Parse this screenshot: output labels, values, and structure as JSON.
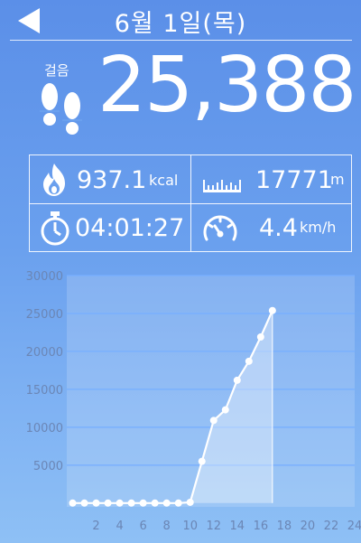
{
  "header": {
    "date": "6월 1일(목)"
  },
  "steps": {
    "label": "걸음",
    "value": "25,388"
  },
  "stats": {
    "calories": {
      "value": "937.1",
      "unit": "kcal"
    },
    "distance": {
      "value": "17771",
      "unit": "m"
    },
    "duration": {
      "value": "04:01:27"
    },
    "speed": {
      "value": "4.4",
      "unit": "km/h"
    }
  },
  "chart_data": {
    "type": "line",
    "title": "",
    "xlabel": "",
    "ylabel": "",
    "x": [
      0,
      1,
      2,
      3,
      4,
      5,
      6,
      7,
      8,
      9,
      10,
      11,
      12,
      13,
      14,
      15,
      16,
      17
    ],
    "values": [
      0,
      0,
      0,
      0,
      0,
      0,
      0,
      0,
      0,
      0,
      100,
      5500,
      10900,
      12300,
      16200,
      18700,
      21900,
      25388
    ],
    "xlim": [
      -0.5,
      24
    ],
    "ylim": [
      -500,
      30000
    ],
    "x_ticks": [
      "2",
      "4",
      "6",
      "8",
      "10",
      "12",
      "14",
      "16",
      "18",
      "20",
      "22",
      "24"
    ],
    "y_ticks": [
      "5000",
      "10000",
      "15000",
      "20000",
      "25000",
      "30000"
    ],
    "grid": true
  }
}
